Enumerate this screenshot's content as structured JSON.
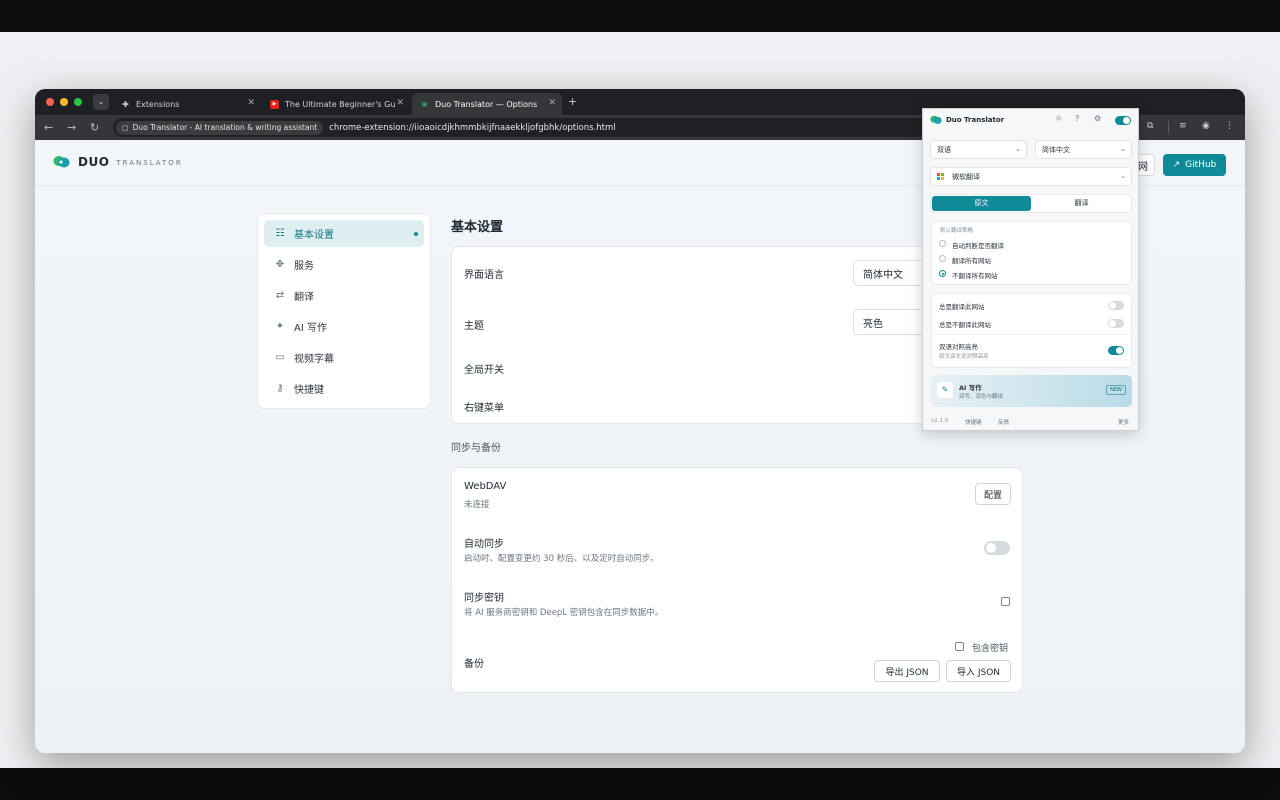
{
  "browser": {
    "tabs": [
      {
        "title": "Extensions"
      },
      {
        "title": "The Ultimate Beginner's Guid"
      },
      {
        "title": "Duo Translator — Options"
      }
    ],
    "new_tab": "+",
    "site_chip": "Duo Translator - AI translation & writing assistant",
    "url": "chrome-extension://iioaoicdjkhmmbkijfnaaekkljofgbhk/options.html"
  },
  "header": {
    "brand_name": "DUO",
    "brand_sub": "TRANSLATOR",
    "lang_button": "网",
    "github_button": "GitHub"
  },
  "sidebar": {
    "items": [
      {
        "label": "基本设置",
        "icon": "sliders-icon"
      },
      {
        "label": "服务",
        "icon": "services-icon"
      },
      {
        "label": "翻译",
        "icon": "translate-icon"
      },
      {
        "label": "AI 写作",
        "icon": "sparkle-icon"
      },
      {
        "label": "视频字幕",
        "icon": "subtitle-icon"
      },
      {
        "label": "快捷键",
        "icon": "key-icon"
      }
    ]
  },
  "main": {
    "title": "基本设置",
    "general": {
      "ui_language_label": "界面语言",
      "ui_language_value": "简体中文",
      "theme_label": "主题",
      "theme_value": "亮色",
      "global_switch_label": "全局开关",
      "context_menu_label": "右键菜单"
    },
    "sync_title": "同步与备份",
    "sync": {
      "webdav_label": "WebDAV",
      "webdav_status": "未连接",
      "webdav_button": "配置",
      "auto_sync_label": "自动同步",
      "auto_sync_desc": "启动时、配置变更约 30 秒后、以及定时自动同步。",
      "auto_sync_on": false,
      "sync_keys_label": "同步密钥",
      "sync_keys_desc": "将 AI 服务商密钥和 DeepL 密钥包含在同步数据中。",
      "sync_keys_checked": false,
      "backup_label": "备份",
      "include_keys_label": "包含密钥",
      "export_button": "导出 JSON",
      "import_button": "导入 JSON"
    }
  },
  "popup": {
    "title": "Duo Translator",
    "enabled": true,
    "mode_select": "双语",
    "target_lang_select": "简体中文",
    "service_select": "微软翻译",
    "segment": [
      "原文",
      "翻译"
    ],
    "default_rule_title": "默认翻译策略",
    "rules": [
      "自动判断是否翻译",
      "翻译所有网站",
      "不翻译所有网站"
    ],
    "selected_rule_index": 2,
    "always_translate_site": "总是翻译此网站",
    "never_translate_site": "总是不翻译此网站",
    "always_translate_on": false,
    "never_translate_on": false,
    "bilingual_highlight_title": "双语对照高亮",
    "bilingual_highlight_desc": "原文译文逐对照高亮",
    "bilingual_highlight_on": true,
    "ai_write_title": "AI 写作",
    "ai_write_desc": "润写、润色与翻译",
    "ai_write_badge": "NEW",
    "footer_version": "v2.1.0",
    "footer_shortcuts": "快捷键",
    "footer_feedback": "反馈",
    "footer_more": "更多",
    "accent_color": "#0f8a98"
  }
}
